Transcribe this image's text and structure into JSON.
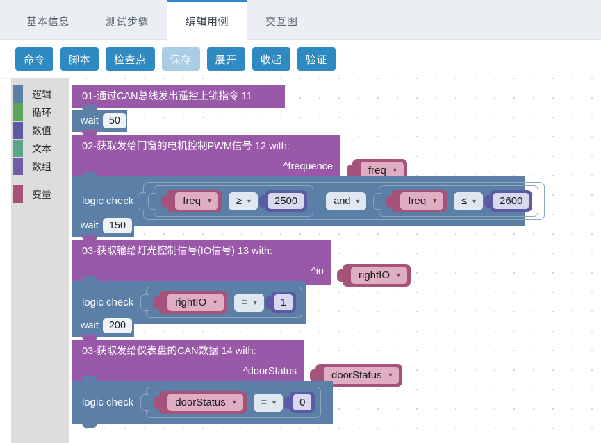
{
  "tabs": [
    {
      "label": "基本信息",
      "active": false
    },
    {
      "label": "测试步骤",
      "active": false
    },
    {
      "label": "编辑用例",
      "active": true
    },
    {
      "label": "交互图",
      "active": false
    }
  ],
  "toolbar": {
    "buttons": [
      {
        "label": "命令",
        "state": "normal"
      },
      {
        "label": "脚本",
        "state": "normal"
      },
      {
        "label": "检查点",
        "state": "normal"
      },
      {
        "label": "保存",
        "state": "muted"
      },
      {
        "label": "展开",
        "state": "normal"
      },
      {
        "label": "收起",
        "state": "normal"
      },
      {
        "label": "验证",
        "state": "normal"
      }
    ]
  },
  "palette": {
    "categories": [
      {
        "label": "逻辑",
        "color": "#5b80a5"
      },
      {
        "label": "循环",
        "color": "#5ba55b"
      },
      {
        "label": "数值",
        "color": "#5b5ba5"
      },
      {
        "label": "文本",
        "color": "#5ba58c"
      },
      {
        "label": "数组",
        "color": "#745ba5"
      },
      {
        "label": "变量",
        "color": "#a5537a"
      }
    ]
  },
  "blocks": {
    "cmd1": {
      "text": "01-通过CAN总线发出遥控上锁指令   11"
    },
    "wait1": {
      "label": "wait",
      "value": "50"
    },
    "cmd2": {
      "text": "02-获取发给门窗的电机控制PWM信号   12   with:",
      "param": "^frequence",
      "var": "freq"
    },
    "check1": {
      "title": "logic check",
      "left": {
        "var": "freq",
        "op": "≥",
        "num": "2500"
      },
      "join": "and",
      "right": {
        "var": "freq",
        "op": "≤",
        "num": "2600"
      }
    },
    "wait2": {
      "label": "wait",
      "value": "150"
    },
    "cmd3": {
      "text": "03-获取输给灯光控制信号(IO信号)     13   with:",
      "param": "^io",
      "var": "rightIO"
    },
    "check2": {
      "title": "logic check",
      "var": "rightIO",
      "op": "=",
      "num": "1"
    },
    "wait3": {
      "label": "wait",
      "value": "200"
    },
    "cmd4": {
      "text": "03-获取发给仪表盘的CAN数据   14   with:",
      "param": "^doorStatus",
      "var": "doorStatus"
    },
    "check3": {
      "title": "logic check",
      "var": "doorStatus",
      "op": "=",
      "num": "0"
    }
  },
  "icons": {
    "caret": "▼"
  }
}
